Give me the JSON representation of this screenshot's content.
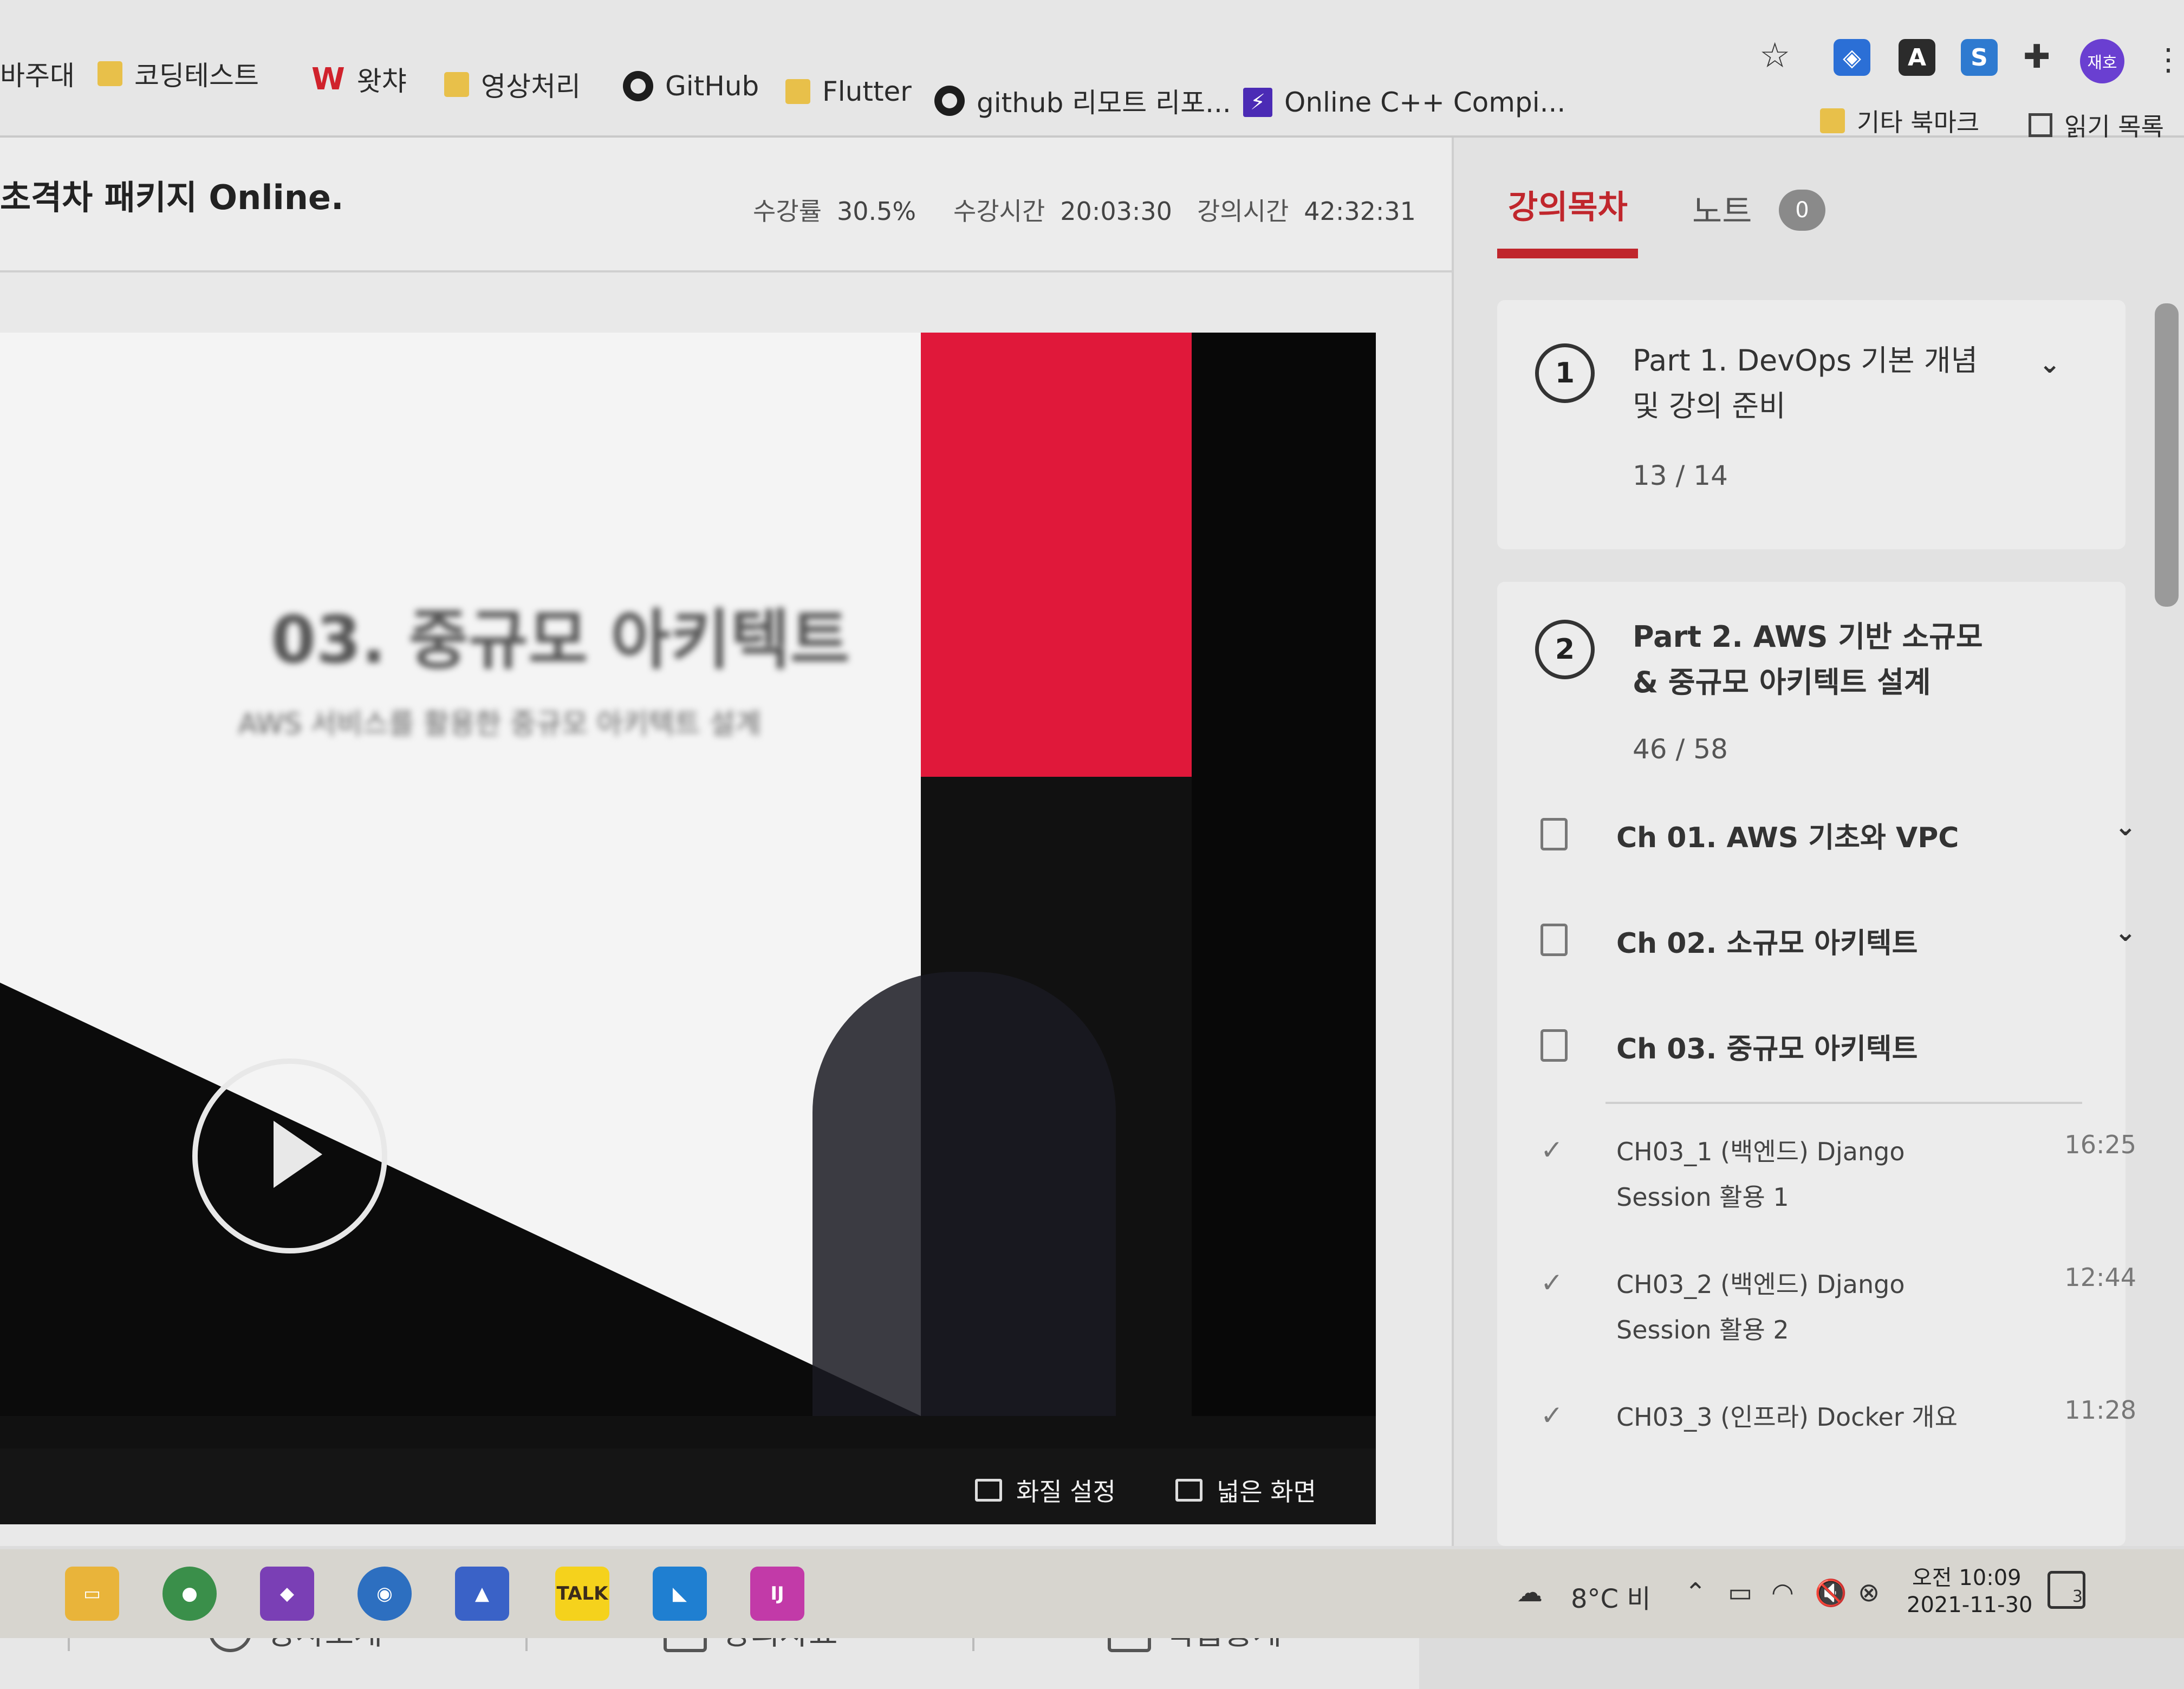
{
  "bookmarks": [
    {
      "label": "바주대",
      "icon": "none"
    },
    {
      "label": "코딩테스트",
      "icon": "folder-icon"
    },
    {
      "label": "왓챠",
      "icon": "watcha-icon"
    },
    {
      "label": "영상처리",
      "icon": "folder-icon"
    },
    {
      "label": "GitHub",
      "icon": "github-icon"
    },
    {
      "label": "Flutter",
      "icon": "folder-icon"
    },
    {
      "label": "github 리모트 리포...",
      "icon": "github-icon"
    },
    {
      "label": "Online C++ Compi...",
      "icon": "bolt-icon"
    }
  ],
  "bookmarks_right": {
    "other": "기타 북마크",
    "reading_list": "읽기 목록"
  },
  "profile": {
    "avatar_text": "재호"
  },
  "course": {
    "title": "초격차 패키지 Online.",
    "progress_label": "수강률",
    "progress_value": "30.5%",
    "watch_time_label": "수강시간",
    "watch_time_value": "20:03:30",
    "lecture_time_label": "강의시간",
    "lecture_time_value": "42:32:31"
  },
  "player": {
    "slide_title": "03. 중규모 아키텍트",
    "slide_subtitle": "AWS 서비스를 활용한 중규모 아키텍트 설계",
    "quality_label": "화질 설정",
    "wide_label": "넓은 화면"
  },
  "bottom_tabs": [
    "강사소개",
    "강의자료",
    "학습통계"
  ],
  "sidebar": {
    "tab_toc": "강의목차",
    "tab_note": "노트",
    "note_count": "0",
    "parts": [
      {
        "num": "1",
        "title": "Part 1. DevOps 기본 개념 및 강의 준비",
        "count": "13 / 14"
      },
      {
        "num": "2",
        "title": "Part 2. AWS 기반 소규모 & 중규모 아키텍트 설계",
        "count": "46 / 58"
      }
    ],
    "chapters": [
      "Ch 01. AWS 기초와 VPC",
      "Ch 02. 소규모 아키텍트",
      "Ch 03. 중규모 아키텍트"
    ],
    "lectures": [
      {
        "title": "CH03_1 (백엔드) Django Session 활용 1",
        "time": "16:25"
      },
      {
        "title": "CH03_2 (백엔드) Django Session 활용 2",
        "time": "12:44"
      },
      {
        "title": "CH03_3 (인프라) Docker 개요",
        "time": "11:28"
      }
    ]
  },
  "taskbar": {
    "weather": "8°C 비",
    "time": "오전 10:09",
    "date": "2021-11-30",
    "notification_count": "3"
  },
  "colors": {
    "accent": "#c0262c",
    "slide_red": "#e0183a"
  }
}
